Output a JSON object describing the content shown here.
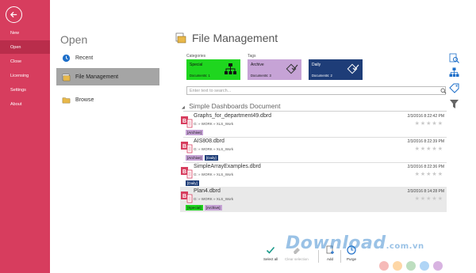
{
  "sidebar": {
    "items": [
      {
        "label": "New"
      },
      {
        "label": "Open"
      },
      {
        "label": "Close"
      },
      {
        "label": "Licensing"
      },
      {
        "label": "Settings"
      },
      {
        "label": "About"
      }
    ],
    "accent": "#d73d5e",
    "active_color": "#b92d4b"
  },
  "open": {
    "title": "Open",
    "items": [
      {
        "label": "Recent",
        "icon": "clock-icon"
      },
      {
        "label": "File Management",
        "icon": "folder-icon"
      },
      {
        "label": "Browse",
        "icon": "folder-open-icon"
      }
    ]
  },
  "main": {
    "title": "File Management",
    "categories_label": "Categories",
    "tags_label": "Tags",
    "tiles": [
      {
        "name": "Special",
        "count": "Documents: 1",
        "color": "#1fd61f"
      },
      {
        "name": "Archive",
        "count": "Documents: 3",
        "color": "#c6a3d6"
      },
      {
        "name": "Daily",
        "count": "Documents: 2",
        "color": "#1e3d78"
      }
    ],
    "search_placeholder": "Enter text to search...",
    "group_title": "Simple Dashboards Document",
    "documents": [
      {
        "name": "Graphs_for_department49.dbrd",
        "path": "G: » WORK » XLS_Work",
        "date": "2/3/2016 8:22:42 PM",
        "stars": "★★★★★",
        "tags": [
          "[Archive]"
        ]
      },
      {
        "name": "AIS808.dbrd",
        "path": "G: » WORK » XLS_Work",
        "date": "2/3/2016 8:22:39 PM",
        "stars": "★★★★★",
        "tags": [
          "[Archive]",
          "[Daily]"
        ]
      },
      {
        "name": "SimpleArrayExamples.dbrd",
        "path": "G: » WORK » XLS_Work",
        "date": "2/3/2016 8:22:36 PM",
        "stars": "★★★★★",
        "tags": [
          "[Daily]"
        ]
      },
      {
        "name": "Plan4.dbrd",
        "path": "G: » WORK » XLS_Work",
        "date": "2/3/2016 8:14:28 PM",
        "stars": "★★★★★",
        "tags": [
          "[Special]",
          "[Archive]"
        ]
      }
    ]
  },
  "toolbar": {
    "select_all": "Select all",
    "clear_selection": "Clear selection",
    "add": "Add",
    "purge": "Purge"
  },
  "watermark": "Download",
  "watermark_suffix": ".com.vn"
}
